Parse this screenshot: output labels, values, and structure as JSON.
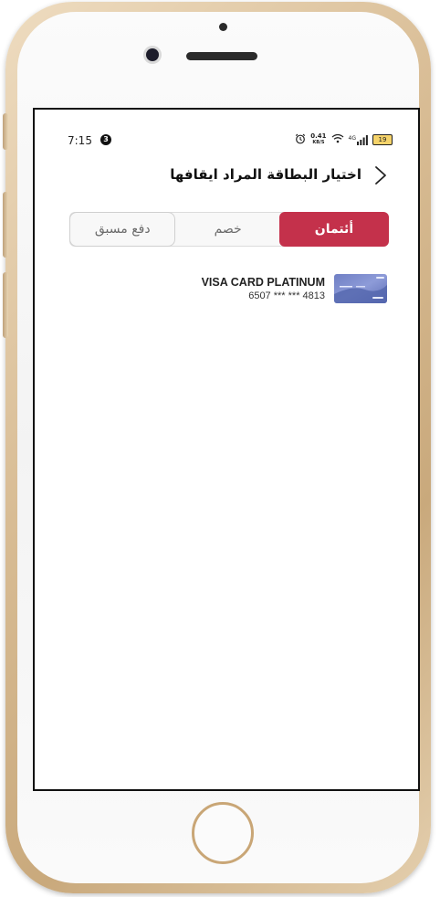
{
  "status_bar": {
    "time": "7:15",
    "notification_count": "3",
    "net_speed_value": "0.41",
    "net_speed_unit": "KB/S",
    "network_type": "4G",
    "battery_level": "19"
  },
  "header": {
    "title": "اختيار البطاقة المراد ايقافها",
    "back_icon": "chevron-right-icon"
  },
  "tabs": [
    {
      "label": "أئتمان",
      "selected": true
    },
    {
      "label": "خصم",
      "selected": false
    },
    {
      "label": "دفع مسبق",
      "selected": false
    }
  ],
  "cards": [
    {
      "name": "VISA CARD PLATINUM",
      "number": "6507 *** *** 4813",
      "thumbnail_icon": "card-thumbnail-icon"
    }
  ],
  "colors": {
    "accent": "#c4314b",
    "phone_frame": "#d8bc94"
  }
}
